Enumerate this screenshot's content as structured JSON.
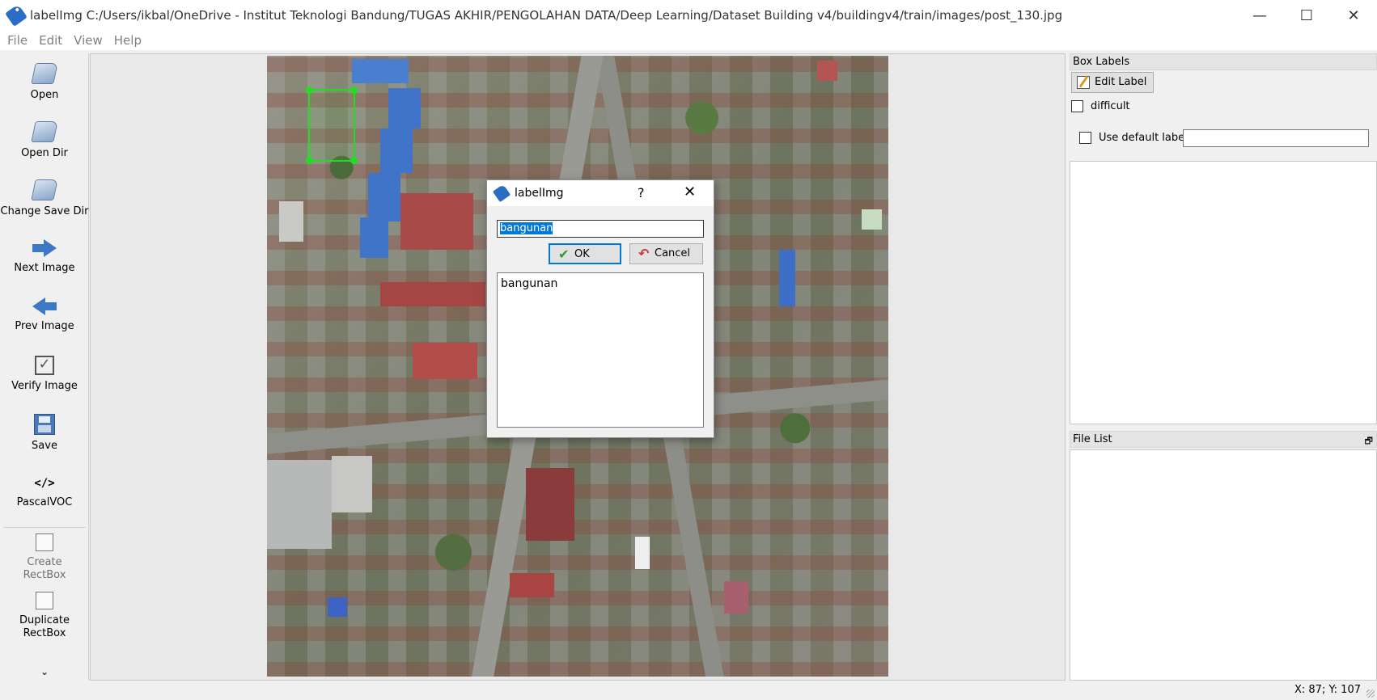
{
  "window": {
    "title": "labelImg C:/Users/ikbal/OneDrive - Institut Teknologi Bandung/TUGAS AKHIR/PENGOLAHAN DATA/Deep Learning/Dataset Building v4/buildingv4/train/images/post_130.jpg",
    "minimize": "—",
    "maximize": "☐",
    "close": "✕"
  },
  "menu": [
    "File",
    "Edit",
    "View",
    "Help"
  ],
  "toolbar": {
    "open": "Open",
    "open_dir": "Open Dir",
    "change_save_dir": "Change Save Dir",
    "next_image": "Next Image",
    "prev_image": "Prev Image",
    "verify_image": "Verify Image",
    "save": "Save",
    "format": "PascalVOC",
    "format_icon": "</>",
    "create_rectbox": "Create\nRectBox",
    "duplicate_rectbox": "Duplicate\nRectBox",
    "more": "⌄"
  },
  "dock": {
    "box_labels_title": "Box Labels",
    "edit_label": "Edit Label",
    "difficult": "difficult",
    "use_default_label": "Use default label",
    "default_label_value": "",
    "file_list_title": "File List",
    "float_icon": "🗗"
  },
  "dialog": {
    "title": "labelImg",
    "help": "?",
    "close": "✕",
    "input_value": "bangunan",
    "ok": "OK",
    "cancel": "Cancel",
    "label_list": [
      "bangunan"
    ]
  },
  "status": {
    "coordinates": "X: 87; Y: 107"
  },
  "colors": {
    "bbox": "#22dd22",
    "selection": "#0078d7",
    "accent_blue": "#2b6cc4"
  },
  "icons": {
    "app": "labelimg-tag-icon",
    "tools": [
      "folder-open-icon",
      "folder-open-icon",
      "folder-open-icon",
      "arrow-right-icon",
      "arrow-left-icon",
      "checkbox-icon",
      "floppy-icon",
      "code-icon",
      "rectbox-icon",
      "duplicate-icon",
      "chevron-down-icon"
    ]
  }
}
